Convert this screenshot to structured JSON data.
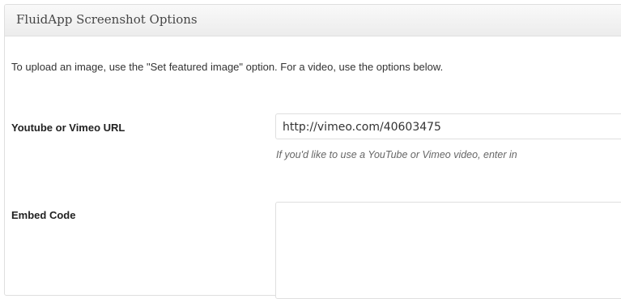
{
  "metabox": {
    "title": "FluidApp Screenshot Options",
    "intro": "To upload an image, use the \"Set featured image\" option. For a video, use the options below."
  },
  "fields": {
    "video_url": {
      "label": "Youtube or Vimeo URL",
      "value": "http://vimeo.com/40603475",
      "hint": "If you'd like to use a YouTube or Vimeo video, enter in"
    },
    "embed_code": {
      "label": "Embed Code",
      "value": ""
    }
  },
  "colors": {
    "panel_border": "#dfdfdf",
    "header_bg": "#f1f1f1",
    "title_text": "#464646",
    "hint_text": "#666666"
  }
}
